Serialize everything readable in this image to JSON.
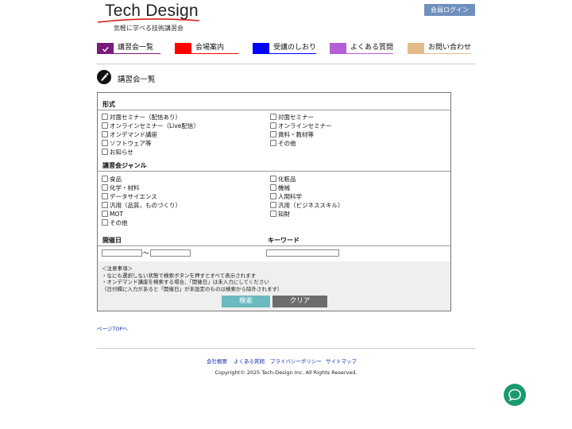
{
  "logo": {
    "title": "Tech Design",
    "subtitle": "気軽に学べる技術講習会"
  },
  "header": {
    "login_label": "会員ログイン"
  },
  "nav": [
    {
      "label": "講習会一覧",
      "color": "#7b1a7b"
    },
    {
      "label": "会場案内",
      "color": "#ff0000"
    },
    {
      "label": "受講のしおり",
      "color": "#0000ff"
    },
    {
      "label": "よくある質問",
      "color": "#b55ed6"
    },
    {
      "label": "お問い合わせ",
      "color": "#e2bc8a"
    }
  ],
  "page": {
    "title": "講習会一覧"
  },
  "format": {
    "title": "形式",
    "left": [
      "対面セミナー（配信あり）",
      "オンラインセミナー（Live配信）",
      "オンデマンド講座",
      "ソフトウェア等",
      "お知らせ"
    ],
    "right": [
      "対面セミナー",
      "オンラインセミナー",
      "資料・教材等",
      "その他"
    ]
  },
  "genre": {
    "title": "講習会ジャンル",
    "left": [
      "食品",
      "化学・材料",
      "データサイエンス",
      "汎用（品質，ものづくり）",
      "MOT",
      "その他"
    ],
    "right": [
      "化粧品",
      "機械",
      "人間科学",
      "汎用（ビジネススキル）",
      "知財"
    ]
  },
  "date": {
    "title": "開催日",
    "separator": "〜",
    "from_value": "",
    "to_value": ""
  },
  "keyword": {
    "title": "キーワード",
    "value": ""
  },
  "notes": [
    "＜注意事項＞",
    "・なにも選択しない状態で検索ボタンを押すとすべて表示されます",
    "・オンデマンド講座を検索する場合、「開催日」は未入力にしてください",
    "（日付欄に入力があると「開催日」が未設定のものは検索から除外されます）"
  ],
  "buttons": {
    "search": "検索",
    "clear": "クリア"
  },
  "pagetop": "ページTOPへ",
  "footer": {
    "links": [
      "会社概要",
      "よくある質問",
      "プライバシーポリシー",
      "サイトマップ"
    ],
    "copyright": "Copyright© 2025 Tech-Design Inc. All Rights Reserved."
  },
  "icons": {
    "page_title": "pen-nib-icon",
    "nav_active": "check-icon",
    "chat": "chat-bubble-icon"
  }
}
